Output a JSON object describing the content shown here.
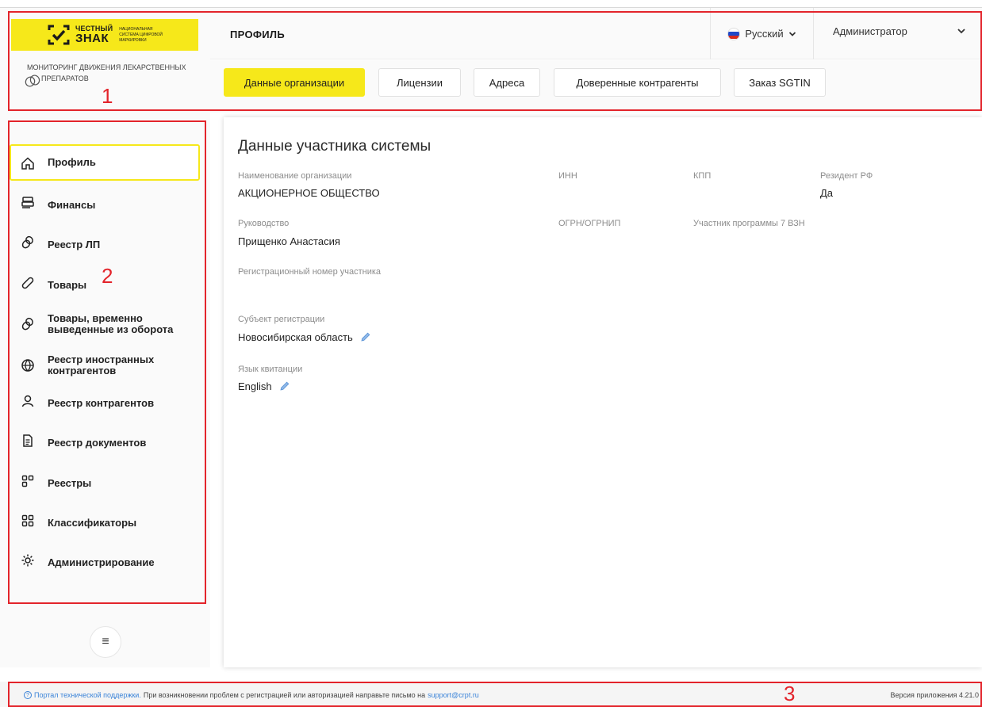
{
  "brand": {
    "logo_word1": "ЧЕСТНЫЙ",
    "logo_word2": "ЗНАК",
    "logo_sub": [
      "НАЦИОНАЛЬНАЯ",
      "СИСТЕМА ЦИФРОВОЙ",
      "МАРКИРОВКИ"
    ],
    "product_name": "МОНИТОРИНГ ДВИЖЕНИЯ ЛЕКАРСТВЕННЫХ ПРЕПАРАТОВ",
    "brand_color": "#f6e81a"
  },
  "header": {
    "page_title": "ПРОФИЛЬ",
    "language": "Русский",
    "user": "Администратор"
  },
  "tabs": [
    {
      "label": "Данные организации",
      "active": true
    },
    {
      "label": "Лицензии"
    },
    {
      "label": "Адреса"
    },
    {
      "label": "Доверенные контрагенты"
    },
    {
      "label": "Заказ SGTIN"
    }
  ],
  "sidebar": {
    "items": [
      {
        "label": "Профиль",
        "icon": "home-icon",
        "active": true
      },
      {
        "label": "Финансы",
        "icon": "wallet-icon"
      },
      {
        "label": "Реестр ЛП",
        "icon": "pills-icon"
      },
      {
        "label": "Товары",
        "icon": "capsule-icon"
      },
      {
        "label": "Товары, временно выведенные из оборота",
        "icon": "pills-icon"
      },
      {
        "label": "Реестр иностранных контрагентов",
        "icon": "globe-icon"
      },
      {
        "label": "Реестр контрагентов",
        "icon": "user-icon"
      },
      {
        "label": "Реестр документов",
        "icon": "document-icon"
      },
      {
        "label": "Реестры",
        "icon": "registry-icon"
      },
      {
        "label": "Классификаторы",
        "icon": "grid-icon"
      },
      {
        "label": "Администрирование",
        "icon": "gear-icon"
      }
    ],
    "toggle_glyph": "≡"
  },
  "main": {
    "section_title": "Данные участника системы",
    "fields": {
      "org_name": {
        "label": "Наименование организации",
        "value": "АКЦИОНЕРНОЕ ОБЩЕСТВО"
      },
      "inn": {
        "label": "ИНН",
        "value": ""
      },
      "kpp": {
        "label": "КПП",
        "value": ""
      },
      "resident": {
        "label": "Резидент РФ",
        "value": "Да"
      },
      "management": {
        "label": "Руководство",
        "value": "Прищенко Анастасия"
      },
      "ogrn": {
        "label": "ОГРН/ОГРНИП",
        "value": ""
      },
      "program": {
        "label": "Участник программы 7 ВЗН",
        "value": ""
      },
      "reg_number": {
        "label": "Регистрационный номер участника",
        "value": ""
      },
      "region": {
        "label": "Субъект регистрации",
        "value": "Новосибирская область"
      },
      "receipt_lang": {
        "label": "Язык квитанции",
        "value": "English"
      }
    }
  },
  "footer": {
    "support_link": "Портал технической поддержки.",
    "support_text": "При возникновении проблем с регистрацией или авторизацией направьте письмо на",
    "support_email": "support@crpt.ru",
    "version": "Версия приложения 4.21.0"
  },
  "annotations": [
    "1",
    "2",
    "3"
  ]
}
